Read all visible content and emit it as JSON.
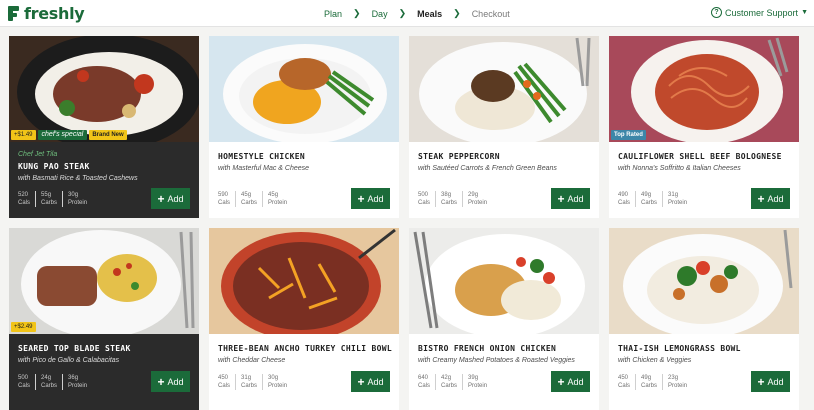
{
  "brand": {
    "name": "freshly",
    "color": "#1b6b3a"
  },
  "nav": {
    "steps": [
      {
        "label": "Plan"
      },
      {
        "label": "Day"
      },
      {
        "label": "Meals",
        "active": true
      },
      {
        "label": "Checkout",
        "muted": true
      }
    ],
    "support_label": "Customer Support"
  },
  "labels": {
    "cals": "Cals",
    "carbs": "Carbs",
    "protein": "Protein",
    "add": "Add"
  },
  "meals": [
    {
      "title": "KUNG PAO STEAK",
      "chef": "Chef Jet Tila",
      "subtitle": "with Basmati Rice & Toasted Cashews",
      "cals": "520",
      "carbs": "55g",
      "protein": "30g",
      "price": "+$1.49",
      "special": "chef's special",
      "badge": "Brand New"
    },
    {
      "title": "HOMESTYLE CHICKEN",
      "subtitle": "with Masterful Mac & Cheese",
      "cals": "590",
      "carbs": "45g",
      "protein": "45g"
    },
    {
      "title": "STEAK PEPPERCORN",
      "subtitle": "with Sautéed Carrots & French Green Beans",
      "cals": "500",
      "carbs": "38g",
      "protein": "29g"
    },
    {
      "title": "CAULIFLOWER SHELL BEEF BOLOGNESE",
      "subtitle": "with Nonna's Soffritto & Italian Cheeses",
      "cals": "490",
      "carbs": "49g",
      "protein": "31g",
      "badge": "Top Rated"
    },
    {
      "title": "SEARED TOP BLADE STEAK",
      "subtitle": "with Pico de Gallo & Calabacitas",
      "cals": "500",
      "carbs": "24g",
      "protein": "36g",
      "price": "+$2.49"
    },
    {
      "title": "THREE-BEAN ANCHO TURKEY CHILI BOWL",
      "subtitle": "with Cheddar Cheese",
      "cals": "450",
      "carbs": "31g",
      "protein": "30g"
    },
    {
      "title": "BISTRO FRENCH ONION CHICKEN",
      "subtitle": "with Creamy Mashed Potatoes & Roasted Veggies",
      "cals": "640",
      "carbs": "42g",
      "protein": "39g"
    },
    {
      "title": "THAI-ISH LEMONGRASS BOWL",
      "subtitle": "with Chicken & Veggies",
      "cals": "450",
      "carbs": "49g",
      "protein": "23g"
    }
  ]
}
